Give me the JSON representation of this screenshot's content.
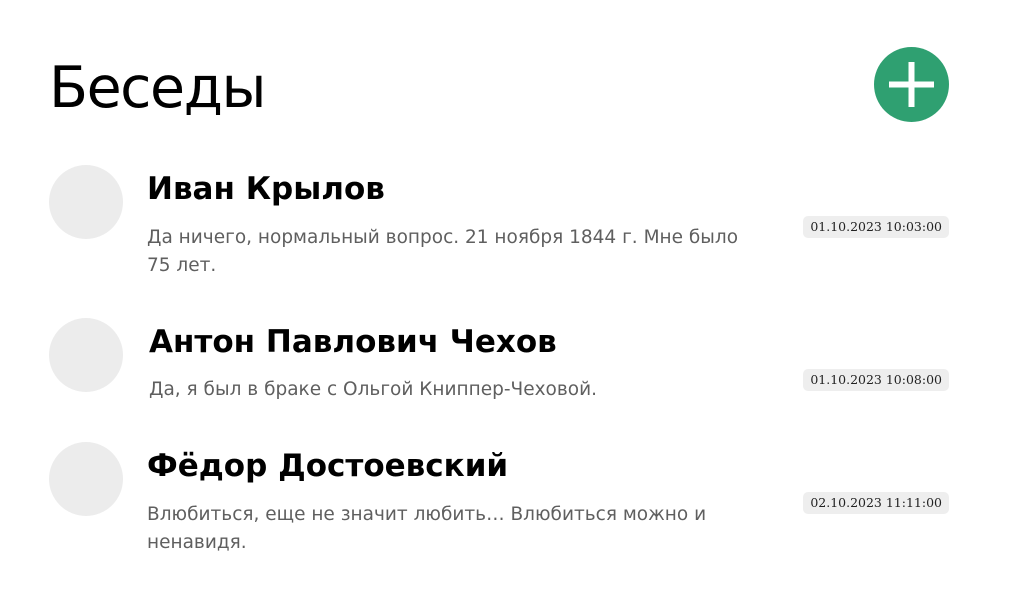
{
  "header": {
    "title": "Беседы",
    "add_button_icon": "plus-icon",
    "accent_color": "#2fa071"
  },
  "chats": [
    {
      "name": "Иван Крылов",
      "message": "Да ничего, нормальный вопрос. 21 ноября 1844 г. Мне было 75 лет.",
      "time": "01.10.2023 10:03:00"
    },
    {
      "name": "Антон Павлович Чехов",
      "message": "Да, я был в браке с Ольгой Книппер-Чеховой.",
      "time": "01.10.2023 10:08:00"
    },
    {
      "name": "Фёдор Достоевский",
      "message": "Влюбиться, еще не значит любить… Влюбиться можно и ненавидя.",
      "time": "02.10.2023 11:11:00"
    }
  ]
}
